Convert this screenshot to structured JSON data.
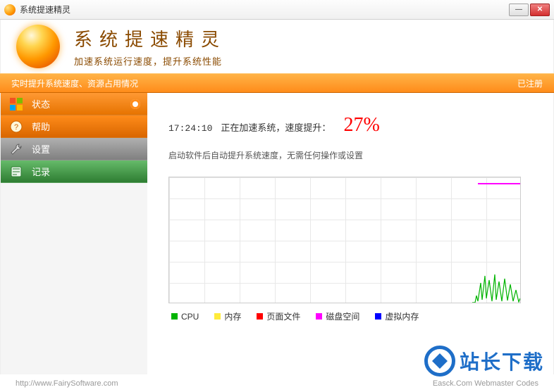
{
  "window": {
    "title": "系统提速精灵"
  },
  "header": {
    "title": "系统提速精灵",
    "subtitle": "加速系统运行速度，提升系统性能"
  },
  "statusbar": {
    "left": "实时提升系统速度、资源占用情况",
    "right": "已注册"
  },
  "nav": {
    "status": "状态",
    "help": "帮助",
    "settings": "设置",
    "log": "记录"
  },
  "main": {
    "time": "17:24:10",
    "message": "正在加速系统，速度提升：",
    "percent": "27%",
    "hint": "启动软件后自动提升系统速度，无需任何操作或设置"
  },
  "chart_data": {
    "type": "line",
    "xlabel": "",
    "ylabel": "",
    "ylim": [
      0,
      100
    ],
    "series": [
      {
        "name": "CPU",
        "color": "#00b400",
        "values": [
          0,
          0,
          0,
          0,
          0,
          0,
          0,
          0,
          0,
          0,
          5,
          25,
          8,
          30,
          12,
          28,
          6,
          22,
          4,
          18,
          3
        ]
      },
      {
        "name": "内存",
        "color": "#ffeb3b",
        "values": []
      },
      {
        "name": "页面文件",
        "color": "#ff0000",
        "values": []
      },
      {
        "name": "磁盘空间",
        "color": "#ff00ff",
        "values": [
          95,
          95,
          95,
          95,
          95,
          95,
          95,
          95,
          95,
          95,
          95,
          95,
          95,
          95,
          95,
          95,
          95,
          95,
          95,
          95,
          95
        ]
      },
      {
        "name": "虚拟内存",
        "color": "#0000ff",
        "values": []
      }
    ],
    "legend": [
      {
        "label": "CPU",
        "color": "#00b400"
      },
      {
        "label": "内存",
        "color": "#ffeb3b"
      },
      {
        "label": "页面文件",
        "color": "#ff0000"
      },
      {
        "label": "磁盘空间",
        "color": "#ff00ff"
      },
      {
        "label": "虚拟内存",
        "color": "#0000ff"
      }
    ]
  },
  "footer": {
    "url": "http://www.FairySoftware.com",
    "credit": "Easck.Com Webmaster Codes"
  },
  "watermark": {
    "text": "站长下载"
  }
}
